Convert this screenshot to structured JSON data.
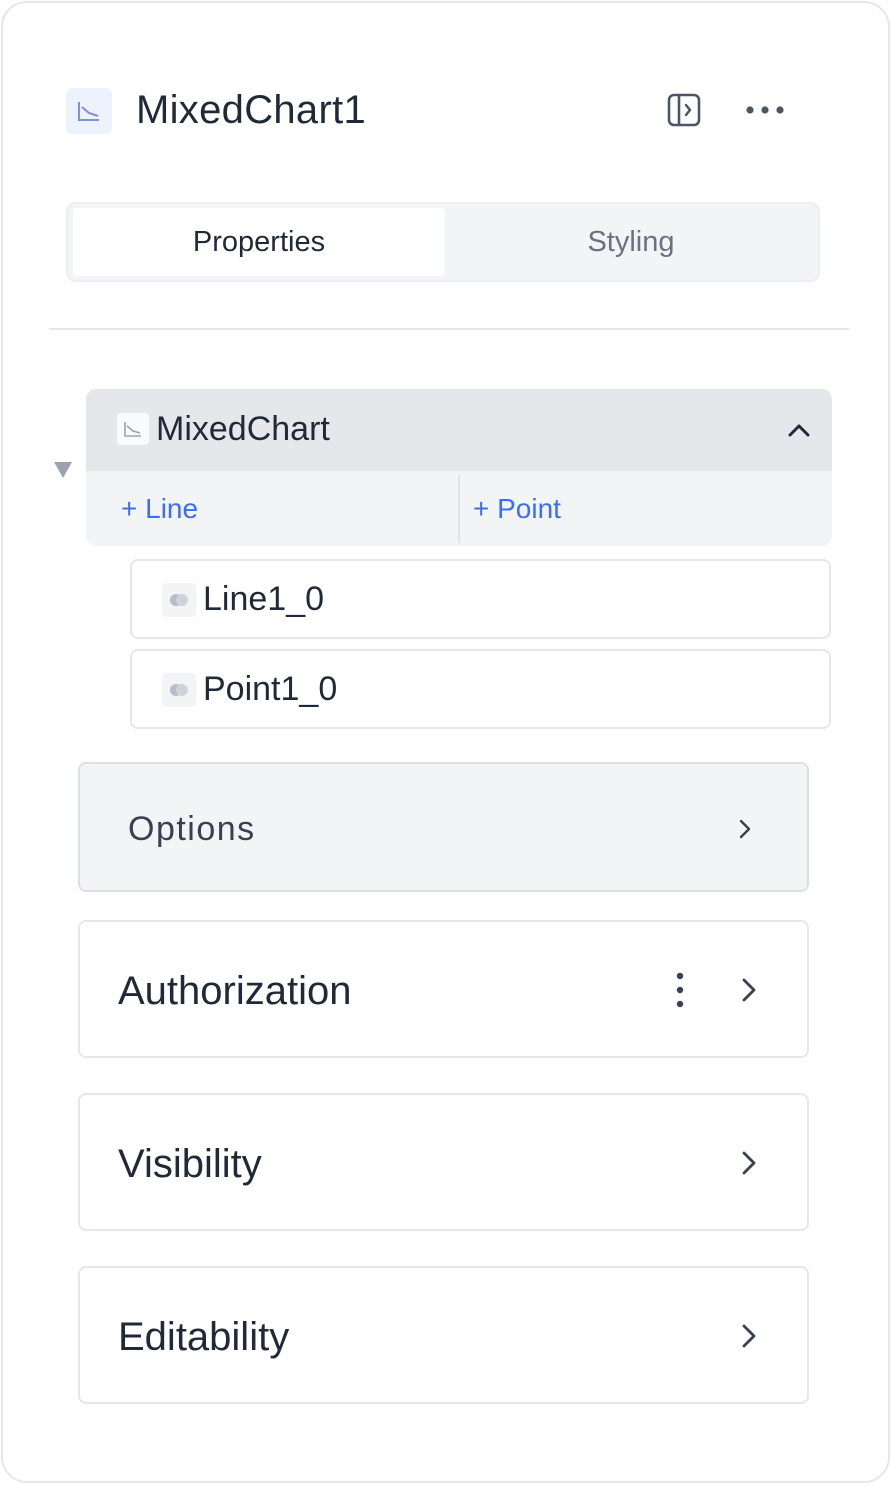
{
  "header": {
    "title": "MixedChart1",
    "icon": "line-chart-icon",
    "actions": [
      "toggle-panel-icon",
      "more-horizontal-icon"
    ]
  },
  "tabs": [
    {
      "label": "Properties",
      "active": true
    },
    {
      "label": "Styling",
      "active": false
    }
  ],
  "tree": {
    "root_label": "MixedChart",
    "expanded": true,
    "add_line_label": "+ Line",
    "add_point_label": "+ Point",
    "items": [
      {
        "label": "Line1_0",
        "icon": "series-icon"
      },
      {
        "label": "Point1_0",
        "icon": "series-icon"
      }
    ]
  },
  "sections": [
    {
      "label": "Options"
    },
    {
      "label": "Authorization"
    },
    {
      "label": "Visibility"
    },
    {
      "label": "Editability"
    }
  ],
  "colors": {
    "accent": "#3b6ef6",
    "text": "#1f2937",
    "muted": "#6b7280",
    "border": "#e5e7eb"
  }
}
